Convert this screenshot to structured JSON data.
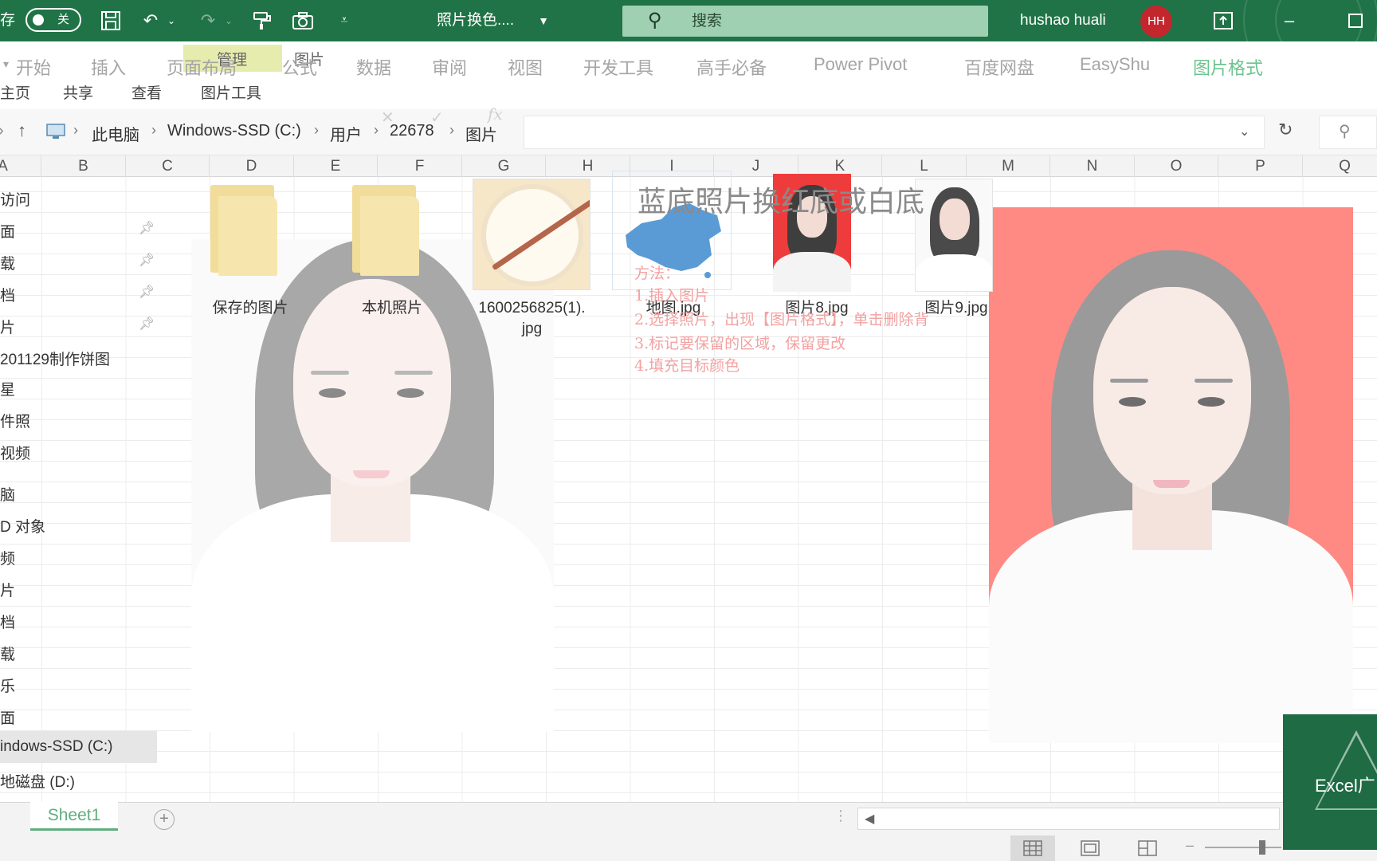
{
  "title_bar": {
    "save_label": "存",
    "autosave_state": "关",
    "doc_title": "照片换色....",
    "search_placeholder": "搜索",
    "user_name": "hushao huali",
    "user_initials": "HH",
    "accent_color": "#207346",
    "avatar_color": "#c4262e"
  },
  "ribbon": {
    "context_group": "管理",
    "context_picture": "图片",
    "tabs": [
      {
        "label": "开始"
      },
      {
        "label": "插入"
      },
      {
        "label": "页面布局"
      },
      {
        "label": "公式"
      },
      {
        "label": "数据"
      },
      {
        "label": "审阅"
      },
      {
        "label": "视图"
      },
      {
        "label": "开发工具"
      },
      {
        "label": "高手必备"
      },
      {
        "label": "Power Pivot"
      },
      {
        "label": "百度网盘"
      },
      {
        "label": "EasyShu"
      },
      {
        "label": "图片格式"
      }
    ]
  },
  "explorer": {
    "tabs": [
      {
        "label": "主页"
      },
      {
        "label": "共享"
      },
      {
        "label": "查看"
      },
      {
        "label": "图片工具"
      }
    ],
    "breadcrumb": [
      "此电脑",
      "Windows-SSD (C:)",
      "用户",
      "22678",
      "图片"
    ],
    "nav_items": [
      {
        "label": "访问"
      },
      {
        "label": "面"
      },
      {
        "label": "载"
      },
      {
        "label": "档"
      },
      {
        "label": "片"
      },
      {
        "label": "201129制作饼图"
      },
      {
        "label": "星"
      },
      {
        "label": "件照"
      },
      {
        "label": "视频"
      },
      {
        "label": "脑"
      },
      {
        "label": "D 对象"
      },
      {
        "label": "频"
      },
      {
        "label": "片"
      },
      {
        "label": "档"
      },
      {
        "label": "载"
      },
      {
        "label": "乐"
      },
      {
        "label": "面"
      },
      {
        "label": "indows-SSD (C:)"
      },
      {
        "label": "地磁盘 (D:)"
      }
    ],
    "files": [
      {
        "name": "保存的图片",
        "icon": "folder-icon"
      },
      {
        "name": "本机照片",
        "icon": "folder-icon"
      },
      {
        "name": "1600256825(1).",
        "name2": "jpg",
        "icon": "plate-spoon-thumbnail"
      },
      {
        "name": "地图.jpg",
        "icon": "china-map-thumbnail"
      },
      {
        "name": "图片8.jpg",
        "icon": "red-portrait-thumbnail"
      },
      {
        "name": "图片9.jpg",
        "icon": "white-portrait-thumbnail"
      }
    ]
  },
  "sheet": {
    "columns": [
      "A",
      "B",
      "C",
      "D",
      "E",
      "F",
      "G",
      "H",
      "I",
      "J",
      "K",
      "L",
      "M",
      "N",
      "O",
      "P",
      "Q"
    ],
    "note_title": "蓝底照片换红底或白底",
    "note_lines": [
      "方法：",
      "1.插入图片",
      "2.选择照片，出现【图片格式】，单击删除背",
      "3.标记要保留的区域，保留更改",
      "4.填充目标颜色"
    ],
    "sheet_tab": "Sheet1",
    "red_background": "#ff8a84"
  },
  "badge": {
    "text": "Excel广"
  }
}
